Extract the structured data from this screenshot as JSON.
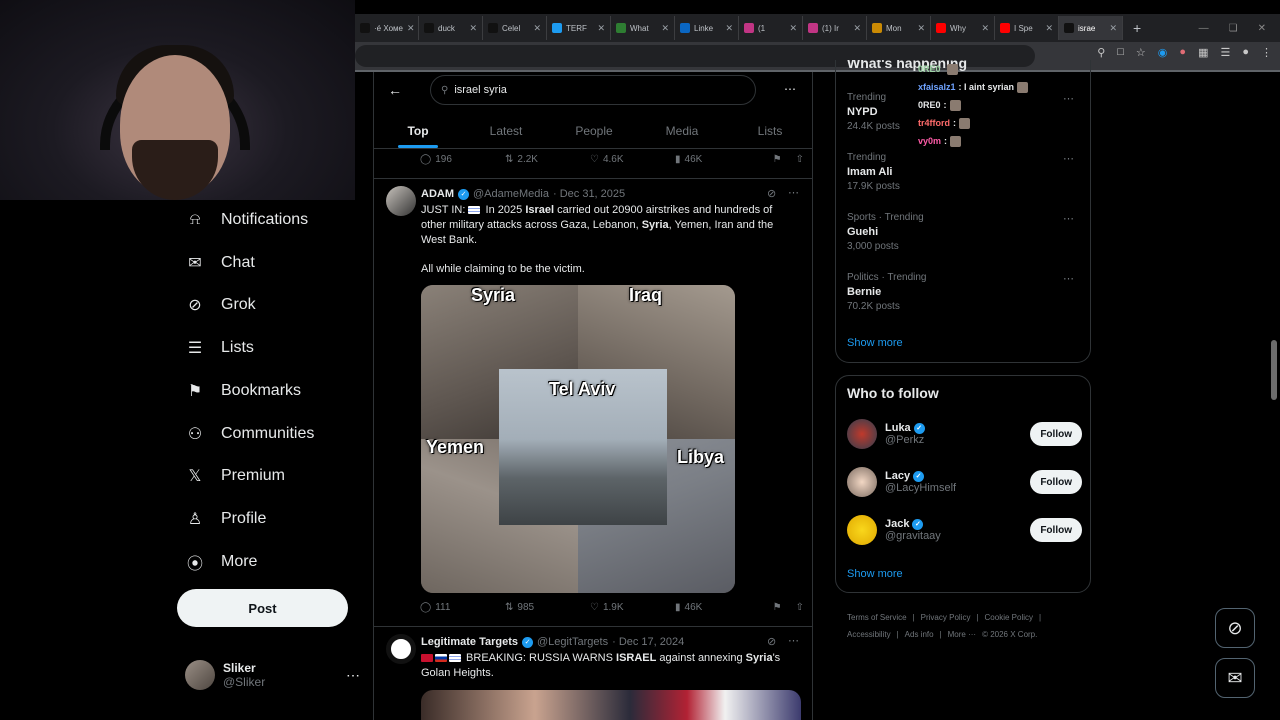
{
  "browser": {
    "tabs": [
      {
        "label": "·é Хоме",
        "icon": "x-icon"
      },
      {
        "label": "duck",
        "icon": "tiktok-icon"
      },
      {
        "label": "Celel",
        "icon": "tiktok-icon"
      },
      {
        "label": "TERF",
        "icon": "bird-icon"
      },
      {
        "label": "What",
        "icon": "page-icon"
      },
      {
        "label": "Linke",
        "icon": "linkedin-icon"
      },
      {
        "label": "(1",
        "icon": "instagram-icon"
      },
      {
        "label": "(1) Ir",
        "icon": "instagram-icon"
      },
      {
        "label": "Mon",
        "icon": "back-icon"
      },
      {
        "label": "Why",
        "icon": "youtube-icon"
      },
      {
        "label": "I Spe",
        "icon": "youtube-icon"
      },
      {
        "label": "israe",
        "icon": "x-icon",
        "active": true
      }
    ]
  },
  "nav": {
    "items": [
      {
        "label": "Notifications",
        "icon": "bell-icon"
      },
      {
        "label": "Chat",
        "icon": "mail-icon"
      },
      {
        "label": "Grok",
        "icon": "grok-icon"
      },
      {
        "label": "Lists",
        "icon": "list-icon"
      },
      {
        "label": "Bookmarks",
        "icon": "bookmark-icon"
      },
      {
        "label": "Communities",
        "icon": "people-icon"
      },
      {
        "label": "Premium",
        "icon": "x-logo-icon"
      },
      {
        "label": "Profile",
        "icon": "person-icon"
      },
      {
        "label": "More",
        "icon": "more-circle-icon"
      }
    ],
    "post_label": "Post",
    "account": {
      "name": "Sliker",
      "handle": "@Sliker"
    }
  },
  "search": {
    "value": "israel syria"
  },
  "tabs": [
    "Top",
    "Latest",
    "People",
    "Media",
    "Lists"
  ],
  "prev_tweet_actions": {
    "replies": "196",
    "reposts": "2.2K",
    "likes": "4.6K",
    "views": "46K"
  },
  "tweet1": {
    "name": "ADAM",
    "handle": "@AdameMedia",
    "date": "· Dec 31, 2025",
    "text_parts": {
      "p1": "JUST IN: ",
      "p2": " In 2025 ",
      "b1": "Israel",
      "p3": " carried out 20900 airstrikes and hundreds of other military attacks across Gaza, Lebanon, ",
      "b2": "Syria",
      "p4": ", Yemen, Iran and the West Bank."
    },
    "text2": "All while claiming to be the victim.",
    "image_labels": {
      "tl": "Syria",
      "tr": "Iraq",
      "center": "Tel Aviv",
      "bl": "Yemen",
      "br": "Libya"
    },
    "actions": {
      "replies": "111",
      "reposts": "985",
      "likes": "1.9K",
      "views": "46K"
    }
  },
  "tweet2": {
    "name": "Legitimate Targets",
    "handle": "@LegitTargets",
    "date": "· Dec 17, 2024",
    "text_parts": {
      "p1": " BREAKING: RUSSIA WARNS ",
      "b1": "ISRAEL",
      "p2": " against annexing ",
      "b2": "Syria",
      "p3": "'s Golan Heights."
    }
  },
  "trends": [
    {
      "meta": "Trending",
      "title": "NYPD",
      "posts": "24.4K posts"
    },
    {
      "meta": "Trending",
      "title": "Imam Ali",
      "posts": "17.9K posts"
    },
    {
      "meta": "Sports · Trending",
      "title": "Guehi",
      "posts": "3,000 posts"
    },
    {
      "meta": "Politics · Trending",
      "title": "Bernie",
      "posts": "70.2K posts"
    }
  ],
  "trends_show_more": "Show more",
  "trends_header_partial": "What's happening",
  "who_to_follow": {
    "title": "Who to follow",
    "users": [
      {
        "name": "Luka",
        "handle": "@Perkz",
        "button": "Follow"
      },
      {
        "name": "Lacy",
        "handle": "@LacyHimself",
        "button": "Follow"
      },
      {
        "name": "Jack",
        "handle": "@gravitaay",
        "button": "Follow"
      }
    ],
    "show_more": "Show more"
  },
  "footer": {
    "links": [
      "Terms of Service",
      "|",
      "Privacy Policy",
      "|",
      "Cookie Policy",
      "|",
      "Accessibility",
      "|",
      "Ads info",
      "|",
      "More ···",
      "© 2026 X Corp."
    ]
  },
  "chat_overlay": [
    {
      "user": "0RE0",
      "msg": "",
      "color": "#9fd6a6"
    },
    {
      "user": "xfaisalz1",
      "msg": ": I aint syrian",
      "color": "#6fa3ff"
    },
    {
      "user": "0RE0",
      "msg": ":",
      "color": "#e7e9ea"
    },
    {
      "user": "tr4fford",
      "msg": ":",
      "color": "#ff6b6b"
    },
    {
      "user": "vy0m",
      "msg": ":",
      "color": "#ff5ca8"
    }
  ],
  "colors": {
    "accent": "#1d9bf0",
    "background": "#000000",
    "border": "#2f3336",
    "muted": "#71767b"
  }
}
